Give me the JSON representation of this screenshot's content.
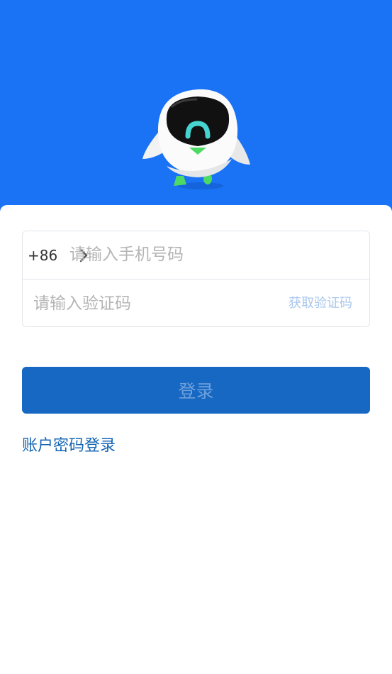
{
  "login_form": {
    "country_code": "+86",
    "phone_placeholder": "请输入手机号码",
    "code_placeholder": "请输入验证码",
    "get_code_label": "获取验证码",
    "submit_label": "登录"
  },
  "alt_login": {
    "label": "账户密码登录"
  },
  "icons": {
    "country_selector": "chevron-right-icon",
    "mascot": "robot-mascot-illustration"
  },
  "colors": {
    "header_bg": "#1a73f5",
    "button_bg": "#1668c2",
    "button_text": "#6ea0dc",
    "link": "#1465b4",
    "get_code_text": "#a9c7ec"
  }
}
